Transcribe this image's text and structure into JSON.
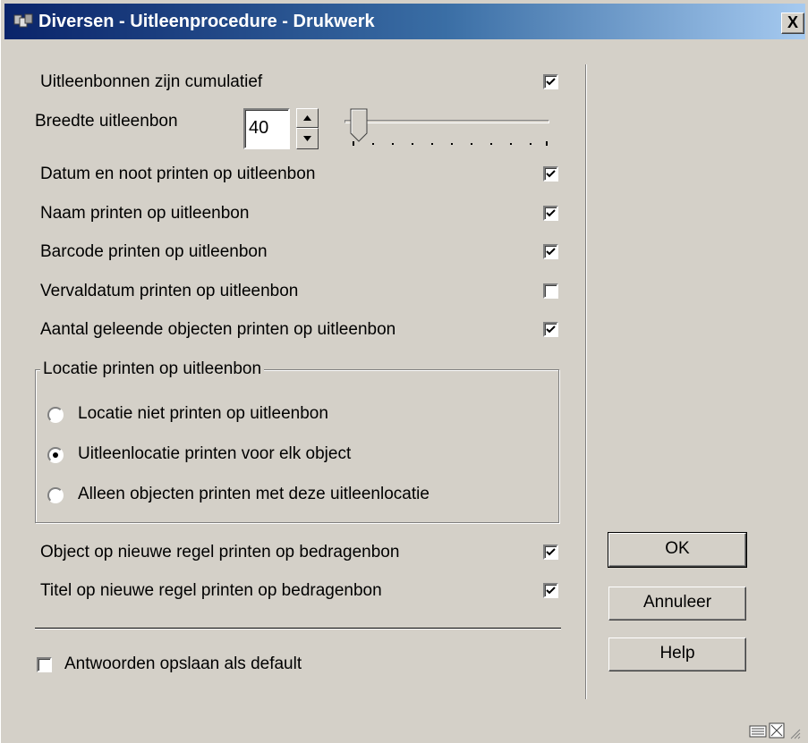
{
  "window": {
    "title": "Diversen - Uitleenprocedure - Drukwerk",
    "close_label": "X"
  },
  "options": {
    "cumulatief": {
      "label": "Uitleenbonnen zijn cumulatief",
      "checked": true
    },
    "breedte": {
      "label": "Breedte uitleenbon",
      "value": "40",
      "slider_fraction": 0.1
    },
    "datum_noot": {
      "label": "Datum en noot printen op uitleenbon",
      "checked": true
    },
    "naam": {
      "label": "Naam printen op uitleenbon",
      "checked": true
    },
    "barcode": {
      "label": "Barcode printen op uitleenbon",
      "checked": true
    },
    "vervaldatum": {
      "label": "Vervaldatum printen op uitleenbon",
      "checked": false
    },
    "aantal": {
      "label": "Aantal geleende objecten printen op uitleenbon",
      "checked": true
    }
  },
  "locatie_group": {
    "title": "Locatie printen op uitleenbon",
    "options": [
      {
        "label": "Locatie niet printen op uitleenbon",
        "selected": false
      },
      {
        "label": "Uitleenlocatie printen voor elk object",
        "selected": true
      },
      {
        "label": "Alleen objecten printen met deze uitleenlocatie",
        "selected": false
      }
    ]
  },
  "bedragenbon": {
    "object": {
      "label": "Object op nieuwe regel printen op bedragenbon",
      "checked": true
    },
    "titel": {
      "label": "Titel op nieuwe regel printen op bedragenbon",
      "checked": true
    }
  },
  "default_option": {
    "label": "Antwoorden opslaan als default",
    "checked": false
  },
  "buttons": {
    "ok": "OK",
    "cancel": "Annuleer",
    "help": "Help"
  },
  "icons": [
    "keyboard-icon",
    "maximize-icon",
    "resize-grip-icon"
  ],
  "colors": {
    "titlebar_start": "#0a246a",
    "titlebar_end": "#a6caf0",
    "face": "#d4d0c8"
  }
}
